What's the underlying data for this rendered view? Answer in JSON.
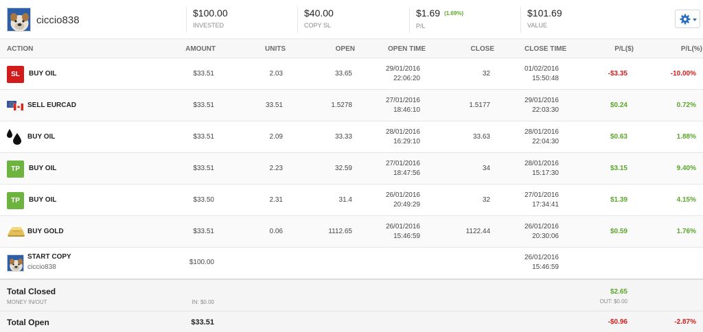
{
  "header": {
    "user_name": "ciccio838",
    "stats": [
      {
        "value": "$100.00",
        "label": "INVESTED"
      },
      {
        "value": "$40.00",
        "label": "COPY SL"
      },
      {
        "value": "$1.69",
        "pct": "(1.69%)",
        "label": "P/L"
      },
      {
        "value": "$101.69",
        "label": "VALUE"
      }
    ],
    "settings_icon": "gear-icon",
    "accent_color": "#2a6fbf"
  },
  "columns": [
    "ACTION",
    "AMOUNT",
    "UNITS",
    "OPEN",
    "OPEN TIME",
    "CLOSE",
    "CLOSE TIME",
    "P/L($)",
    "P/L(%)"
  ],
  "trades": [
    {
      "icon": "stop-loss-badge",
      "badge": "SL",
      "action": "BUY OIL",
      "amount": "$33.51",
      "units": "2.03",
      "open": "33.65",
      "open_date": "29/01/2016",
      "open_time": "22:06:20",
      "close": "32",
      "close_date": "01/02/2016",
      "close_time": "15:50:48",
      "pl_usd": "-$3.35",
      "pl_pct": "-10.00%",
      "positive": false
    },
    {
      "icon": "eurcad-flags-icon",
      "badge": "",
      "action": "SELL EURCAD",
      "amount": "$33.51",
      "units": "33.51",
      "open": "1.5278",
      "open_date": "27/01/2016",
      "open_time": "18:46:10",
      "close": "1.5177",
      "close_date": "29/01/2016",
      "close_time": "22:03:30",
      "pl_usd": "$0.24",
      "pl_pct": "0.72%",
      "positive": true
    },
    {
      "icon": "oil-drops-icon",
      "badge": "",
      "action": "BUY OIL",
      "amount": "$33.51",
      "units": "2.09",
      "open": "33.33",
      "open_date": "28/01/2016",
      "open_time": "16:29:10",
      "close": "33.63",
      "close_date": "28/01/2016",
      "close_time": "22:04:30",
      "pl_usd": "$0.63",
      "pl_pct": "1.88%",
      "positive": true
    },
    {
      "icon": "take-profit-badge",
      "badge": "TP",
      "action": "BUY OIL",
      "amount": "$33.51",
      "units": "2.23",
      "open": "32.59",
      "open_date": "27/01/2016",
      "open_time": "18:47:56",
      "close": "34",
      "close_date": "28/01/2016",
      "close_time": "15:17:30",
      "pl_usd": "$3.15",
      "pl_pct": "9.40%",
      "positive": true
    },
    {
      "icon": "take-profit-badge",
      "badge": "TP",
      "action": "BUY OIL",
      "amount": "$33.50",
      "units": "2.31",
      "open": "31.4",
      "open_date": "26/01/2016",
      "open_time": "20:49:29",
      "close": "32",
      "close_date": "27/01/2016",
      "close_time": "17:34:41",
      "pl_usd": "$1.39",
      "pl_pct": "4.15%",
      "positive": true
    },
    {
      "icon": "gold-bar-icon",
      "badge": "",
      "action": "BUY GOLD",
      "amount": "$33.51",
      "units": "0.06",
      "open": "1112.65",
      "open_date": "26/01/2016",
      "open_time": "15:46:59",
      "close": "1122.44",
      "close_date": "26/01/2016",
      "close_time": "20:30:06",
      "pl_usd": "$0.59",
      "pl_pct": "1.76%",
      "positive": true
    }
  ],
  "start_copy": {
    "icon": "avatar",
    "action": "START COPY",
    "user": "ciccio838",
    "amount": "$100.00",
    "date": "26/01/2016",
    "time": "15:46:59"
  },
  "totals_closed": {
    "title": "Total Closed",
    "subtitle": "MONEY IN/OUT",
    "in": "IN: $0.00",
    "pl_usd": "$2.65",
    "out": "OUT: $0.00"
  },
  "totals_open": {
    "title": "Total Open",
    "amount": "$33.51",
    "pl_usd": "-$0.96",
    "pl_pct": "-2.87%"
  },
  "colors": {
    "positive": "#5aa52a",
    "negative": "#d21c1c",
    "sl_badge": "#d21c1c",
    "tp_badge": "#6db33f"
  }
}
